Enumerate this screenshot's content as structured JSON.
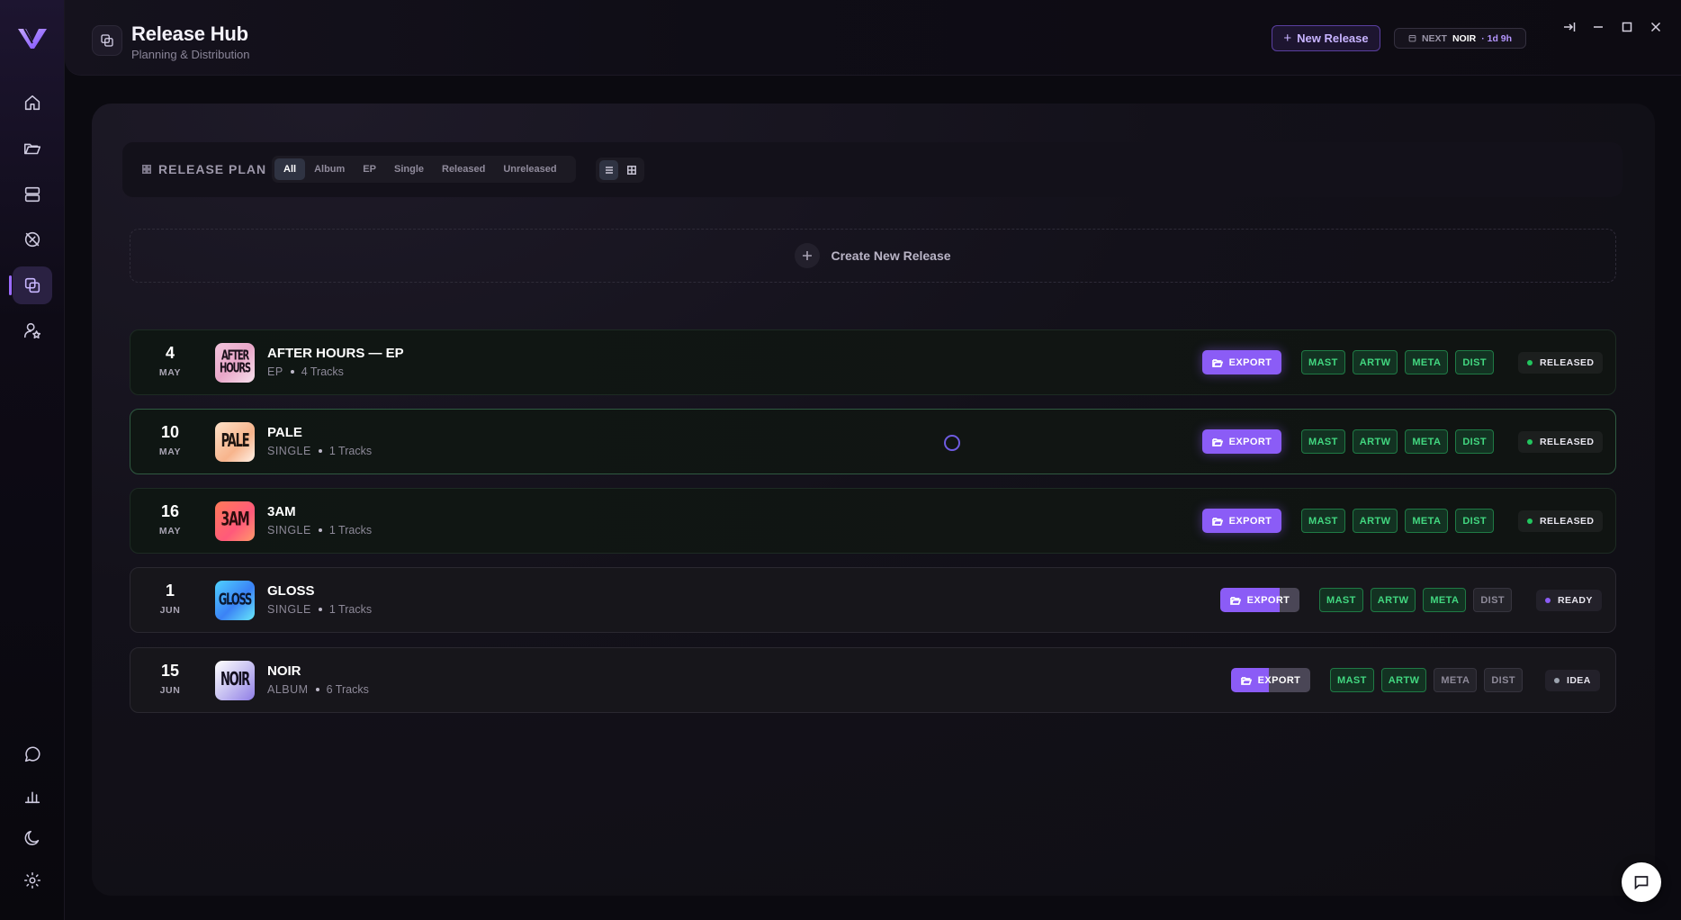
{
  "header": {
    "title": "Release Hub",
    "subtitle": "Planning & Distribution",
    "new_release_label": "New Release",
    "next_label": "NEXT",
    "next_name": "NOIR",
    "next_time": "· 1d 9h"
  },
  "filter": {
    "label": "RELEASE PLAN",
    "tabs": [
      "All",
      "Album",
      "EP",
      "Single",
      "Released",
      "Unreleased"
    ],
    "active_tab": "All",
    "view": "list"
  },
  "create_label": "Create New Release",
  "releases": [
    {
      "day": "4",
      "month": "MAY",
      "art_text": "AFTER HOURS",
      "title": "AFTER HOURS — EP",
      "type": "EP",
      "tracks": "4 Tracks",
      "export_label": "EXPORT",
      "tags": [
        "MAST",
        "ARTW",
        "META",
        "DIST"
      ],
      "status": "RELEASED"
    },
    {
      "day": "10",
      "month": "MAY",
      "art_text": "PALE",
      "title": "PALE",
      "type": "SINGLE",
      "tracks": "1 Tracks",
      "export_label": "EXPORT",
      "tags": [
        "MAST",
        "ARTW",
        "META",
        "DIST"
      ],
      "status": "RELEASED"
    },
    {
      "day": "16",
      "month": "MAY",
      "art_text": "3AM",
      "title": "3AM",
      "type": "SINGLE",
      "tracks": "1 Tracks",
      "export_label": "EXPORT",
      "tags": [
        "MAST",
        "ARTW",
        "META",
        "DIST"
      ],
      "status": "RELEASED"
    },
    {
      "day": "1",
      "month": "JUN",
      "art_text": "GLOSS",
      "title": "GLOSS",
      "type": "SINGLE",
      "tracks": "1 Tracks",
      "export_label": "EXPORT",
      "tags": [
        "MAST",
        "ARTW",
        "META",
        "DIST"
      ],
      "status": "READY"
    },
    {
      "day": "15",
      "month": "JUN",
      "art_text": "NOIR",
      "title": "NOIR",
      "type": "ALBUM",
      "tracks": "6 Tracks",
      "export_label": "EXPORT",
      "tags": [
        "MAST",
        "ARTW",
        "META",
        "DIST"
      ],
      "status": "IDEA"
    }
  ],
  "colors": {
    "accent": "#8b5cf6",
    "tag_on": "#42d780",
    "status_released": "#22c55e",
    "status_ready": "#8b5cf6",
    "status_idea": "#9ca3af"
  }
}
